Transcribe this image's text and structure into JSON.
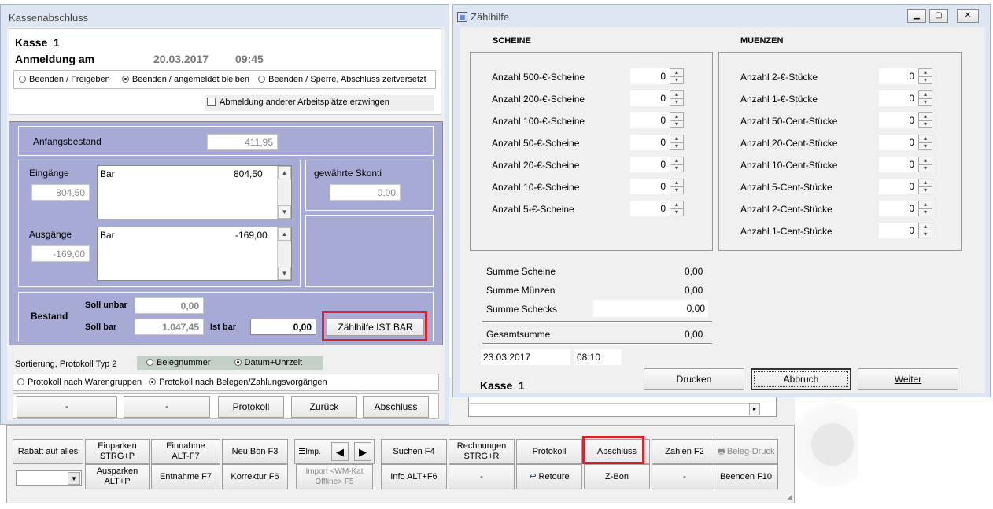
{
  "bg_window": {
    "tb_row1": [
      {
        "label": "Rabatt auf alles"
      },
      {
        "label": "Einparken\nSTRG+P"
      },
      {
        "label": "Einnahme\nALT-F7"
      },
      {
        "label": "Neu Bon F3"
      },
      {
        "label": "Imp."
      },
      {
        "label": "Suchen F4"
      },
      {
        "label": "Rechnungen\nSTRG+R"
      },
      {
        "label": "Protokoll"
      },
      {
        "label": "Abschluss"
      },
      {
        "label": "Zahlen F2"
      },
      {
        "label": "Beleg-Druck"
      }
    ],
    "tb_row2": [
      {
        "label": "Ausparken\nALT+P"
      },
      {
        "label": "Entnahme F7"
      },
      {
        "label": "Korrektur F6"
      },
      {
        "label": "Import <WM-Kat\nOffline> F5"
      },
      {
        "label": "Info ALT+F6"
      },
      {
        "label": "-"
      },
      {
        "label": "Retoure"
      },
      {
        "label": "Z-Bon"
      },
      {
        "label": "-"
      },
      {
        "label": "Beenden F10"
      }
    ]
  },
  "kasse_window": {
    "title": "Kassenabschluss",
    "kasse_label": "Kasse  1",
    "anmeldung_label": "Anmeldung am",
    "date": "20.03.2017",
    "time": "09:45",
    "radio_options": [
      "Beenden / Freigeben",
      "Beenden / angemeldet bleiben",
      "Beenden / Sperre, Abschluss zeitversetzt"
    ],
    "checkbox_label": "Abmeldung anderer Arbeitsplätze erzwingen",
    "anfangsbestand_label": "Anfangsbestand",
    "anfangsbestand_value": "411,95",
    "eingaenge_label": "Eingänge",
    "eingaenge_value": "804,50",
    "eingaenge_list": {
      "name": "Bar",
      "amount": "804,50"
    },
    "ausgaenge_label": "Ausgänge",
    "ausgaenge_value": "-169,00",
    "ausgaenge_list": {
      "name": "Bar",
      "amount": "-169,00"
    },
    "skonti_label": "gewährte Skonti",
    "skonti_value": "0,00",
    "bestand_label": "Bestand",
    "soll_unbar_label": "Soll unbar",
    "soll_unbar_value": "0,00",
    "soll_bar_label": "Soll bar",
    "soll_bar_value": "1.047,45",
    "ist_bar_label": "Ist bar",
    "ist_bar_value": "0,00",
    "zaehlhilfe_button": "Zählhilfe IST BAR",
    "sortierung_label": "Sortierung, Protokoll Typ 2",
    "sort_options": [
      "Belegnummer",
      "Datum+Uhrzeit"
    ],
    "protokoll_options": [
      "Protokoll nach Warengruppen",
      "Protokoll nach Belegen/Zahlungsvorgängen"
    ],
    "bottom_buttons": [
      "-",
      "-",
      "Protokoll",
      "Zurück",
      "Abschluss"
    ]
  },
  "zaehl_window": {
    "title": "Zählhilfe",
    "scheine_header": "SCHEINE",
    "muenzen_header": "MUENZEN",
    "scheine": [
      {
        "label": "Anzahl 500-€-Scheine",
        "value": "0"
      },
      {
        "label": "Anzahl 200-€-Scheine",
        "value": "0"
      },
      {
        "label": "Anzahl 100-€-Scheine",
        "value": "0"
      },
      {
        "label": "Anzahl 50-€-Scheine",
        "value": "0"
      },
      {
        "label": "Anzahl 20-€-Scheine",
        "value": "0"
      },
      {
        "label": "Anzahl 10-€-Scheine",
        "value": "0"
      },
      {
        "label": "Anzahl 5-€-Scheine",
        "value": "0"
      }
    ],
    "muenzen": [
      {
        "label": "Anzahl 2-€-Stücke",
        "value": "0"
      },
      {
        "label": "Anzahl 1-€-Stücke",
        "value": "0"
      },
      {
        "label": "Anzahl 50-Cent-Stücke",
        "value": "0"
      },
      {
        "label": "Anzahl 20-Cent-Stücke",
        "value": "0"
      },
      {
        "label": "Anzahl 10-Cent-Stücke",
        "value": "0"
      },
      {
        "label": "Anzahl 5-Cent-Stücke",
        "value": "0"
      },
      {
        "label": "Anzahl 2-Cent-Stücke",
        "value": "0"
      },
      {
        "label": "Anzahl 1-Cent-Stücke",
        "value": "0"
      }
    ],
    "summe_scheine_label": "Summe Scheine",
    "summe_scheine_value": "0,00",
    "summe_muenzen_label": "Summe Münzen",
    "summe_muenzen_value": "0,00",
    "summe_schecks_label": "Summe Schecks",
    "summe_schecks_value": "0,00",
    "gesamtsumme_label": "Gesamtsumme",
    "gesamtsumme_value": "0,00",
    "date": "23.03.2017",
    "time": "08:10",
    "kasse_label": "Kasse  1",
    "drucken_button": "Drucken",
    "abbruch_button": "Abbruch",
    "weiter_button": "Weiter"
  }
}
